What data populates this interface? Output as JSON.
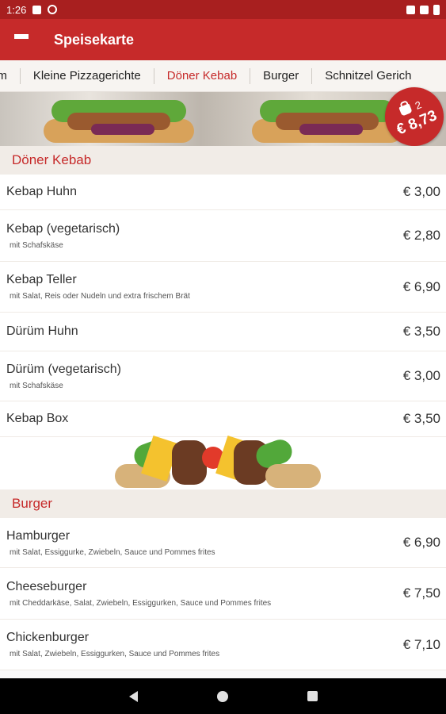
{
  "statusbar": {
    "time": "1:26"
  },
  "appbar": {
    "title": "Speisekarte"
  },
  "tabs": [
    "em",
    "Kleine Pizzagerichte",
    "Döner Kebab",
    "Burger",
    "Schnitzel Gerich"
  ],
  "active_tab": "Döner Kebab",
  "cart": {
    "count": "2",
    "total": "€ 8,73"
  },
  "sections": [
    {
      "title": "Döner Kebab",
      "items": [
        {
          "name": "Kebap Huhn",
          "desc": "",
          "price": "€ 3,00"
        },
        {
          "name": "Kebap (vegetarisch)",
          "desc": "mit Schafskäse",
          "price": "€ 2,80"
        },
        {
          "name": "Kebap Teller",
          "desc": "mit Salat, Reis oder Nudeln und extra frischem Brät",
          "price": "€ 6,90"
        },
        {
          "name": "Dürüm Huhn",
          "desc": "",
          "price": "€ 3,50"
        },
        {
          "name": "Dürüm (vegetarisch)",
          "desc": "mit Schafskäse",
          "price": "€ 3,00"
        },
        {
          "name": "Kebap Box",
          "desc": "",
          "price": "€ 3,50"
        }
      ]
    },
    {
      "title": "Burger",
      "items": [
        {
          "name": "Hamburger",
          "desc": "mit Salat, Essiggurke, Zwiebeln, Sauce und Pommes frites",
          "price": "€ 6,90"
        },
        {
          "name": "Cheeseburger",
          "desc": "mit Cheddarkäse, Salat, Zwiebeln, Essiggurken, Sauce und Pommes frites",
          "price": "€ 7,50"
        },
        {
          "name": "Chickenburger",
          "desc": "mit Salat, Zwiebeln, Essiggurken, Sauce und Pommes frites",
          "price": "€ 7,10"
        }
      ]
    }
  ],
  "colors": {
    "primary": "#c62a2a",
    "statusbar": "#a81f1f",
    "section_bg": "#f1ece7"
  }
}
